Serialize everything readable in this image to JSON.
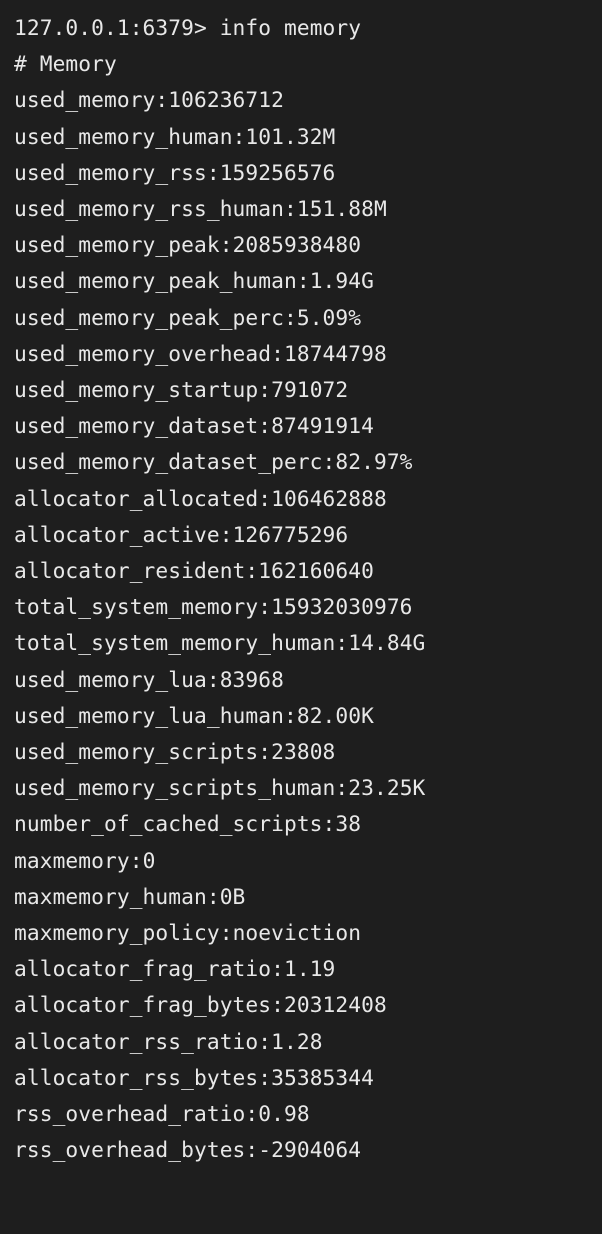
{
  "prompt": "127.0.0.1:6379>",
  "command": "info memory",
  "section_header": "# Memory",
  "metrics": [
    {
      "key": "used_memory",
      "value": "106236712"
    },
    {
      "key": "used_memory_human",
      "value": "101.32M"
    },
    {
      "key": "used_memory_rss",
      "value": "159256576"
    },
    {
      "key": "used_memory_rss_human",
      "value": "151.88M"
    },
    {
      "key": "used_memory_peak",
      "value": "2085938480"
    },
    {
      "key": "used_memory_peak_human",
      "value": "1.94G"
    },
    {
      "key": "used_memory_peak_perc",
      "value": "5.09%"
    },
    {
      "key": "used_memory_overhead",
      "value": "18744798"
    },
    {
      "key": "used_memory_startup",
      "value": "791072"
    },
    {
      "key": "used_memory_dataset",
      "value": "87491914"
    },
    {
      "key": "used_memory_dataset_perc",
      "value": "82.97%"
    },
    {
      "key": "allocator_allocated",
      "value": "106462888"
    },
    {
      "key": "allocator_active",
      "value": "126775296"
    },
    {
      "key": "allocator_resident",
      "value": "162160640"
    },
    {
      "key": "total_system_memory",
      "value": "15932030976"
    },
    {
      "key": "total_system_memory_human",
      "value": "14.84G"
    },
    {
      "key": "used_memory_lua",
      "value": "83968"
    },
    {
      "key": "used_memory_lua_human",
      "value": "82.00K"
    },
    {
      "key": "used_memory_scripts",
      "value": "23808"
    },
    {
      "key": "used_memory_scripts_human",
      "value": "23.25K"
    },
    {
      "key": "number_of_cached_scripts",
      "value": "38"
    },
    {
      "key": "maxmemory",
      "value": "0"
    },
    {
      "key": "maxmemory_human",
      "value": "0B"
    },
    {
      "key": "maxmemory_policy",
      "value": "noeviction"
    },
    {
      "key": "allocator_frag_ratio",
      "value": "1.19"
    },
    {
      "key": "allocator_frag_bytes",
      "value": "20312408"
    },
    {
      "key": "allocator_rss_ratio",
      "value": "1.28"
    },
    {
      "key": "allocator_rss_bytes",
      "value": "35385344"
    },
    {
      "key": "rss_overhead_ratio",
      "value": "0.98"
    },
    {
      "key": "rss_overhead_bytes",
      "value": "-2904064"
    }
  ]
}
